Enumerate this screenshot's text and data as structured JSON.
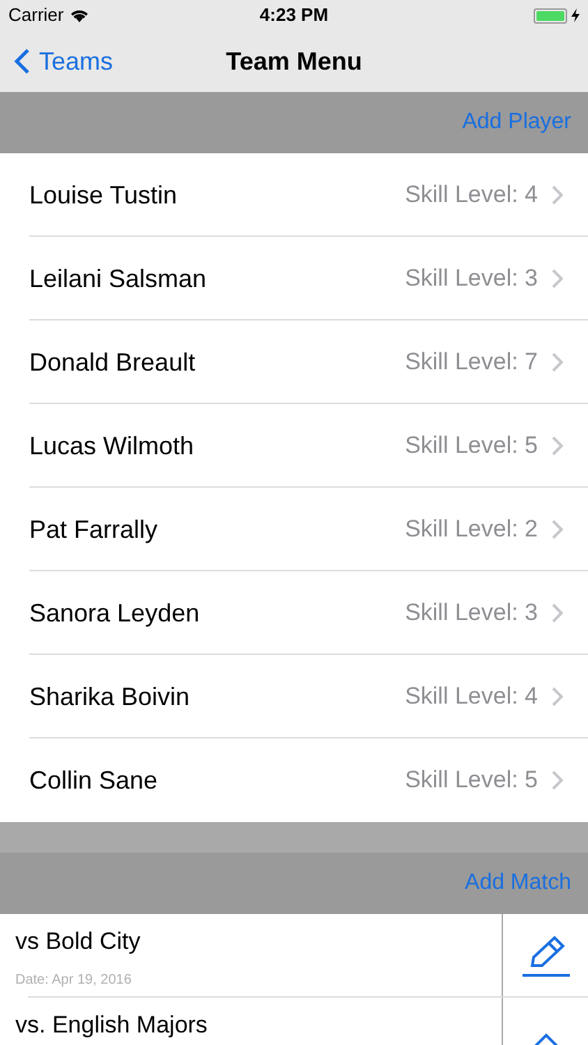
{
  "status_bar": {
    "carrier": "Carrier",
    "time": "4:23 PM",
    "battery": {
      "level": 1
    }
  },
  "nav": {
    "back": "Teams",
    "title": "Team Menu"
  },
  "players_section": {
    "action": "Add Player"
  },
  "players": [
    {
      "name": "Louise Tustin",
      "skill": "Skill Level: 4"
    },
    {
      "name": "Leilani Salsman",
      "skill": "Skill Level: 3"
    },
    {
      "name": "Donald Breault",
      "skill": "Skill Level: 7"
    },
    {
      "name": "Lucas Wilmoth",
      "skill": "Skill Level: 5"
    },
    {
      "name": "Pat Farrally",
      "skill": "Skill Level: 2"
    },
    {
      "name": "Sanora Leyden",
      "skill": "Skill Level: 3"
    },
    {
      "name": "Sharika Boivin",
      "skill": "Skill Level: 4"
    },
    {
      "name": "Collin Sane",
      "skill": "Skill Level: 5"
    }
  ],
  "matches_section": {
    "action": "Add Match"
  },
  "matches": [
    {
      "title": "vs Bold City",
      "date": "Date: Apr 19, 2016",
      "kind": "edit"
    },
    {
      "title": "vs. English Majors",
      "kind": "up"
    }
  ]
}
